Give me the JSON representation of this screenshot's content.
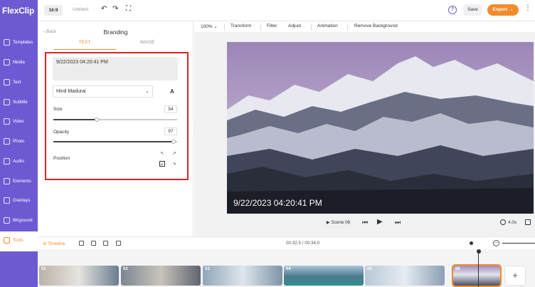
{
  "app": {
    "logo": "FlexClip",
    "ratio": "16:9",
    "project_title": "Untitled",
    "help": "?",
    "save_label": "Save",
    "export_label": "Export →",
    "more": "⋮"
  },
  "sidebar": {
    "items": [
      {
        "label": "Templates",
        "icon": "templates-icon"
      },
      {
        "label": "Media",
        "icon": "media-icon"
      },
      {
        "label": "Text",
        "icon": "text-icon"
      },
      {
        "label": "Subtitle",
        "icon": "subtitle-icon"
      },
      {
        "label": "Video",
        "icon": "video-icon"
      },
      {
        "label": "Photo",
        "icon": "photo-icon"
      },
      {
        "label": "Audio",
        "icon": "audio-icon"
      },
      {
        "label": "Elements",
        "icon": "elements-icon"
      },
      {
        "label": "Overlays",
        "icon": "overlays-icon"
      },
      {
        "label": "BKground",
        "icon": "background-icon"
      },
      {
        "label": "Tools",
        "icon": "tools-icon",
        "active": true
      }
    ]
  },
  "panel": {
    "back_label": "Back",
    "title": "Branding",
    "tabs": [
      "TEXT",
      "IMAGE"
    ],
    "active_tab": "TEXT",
    "text_value": "9/22/2023 04:20:41 PM",
    "font": "Hind Madurai",
    "font_style_glyph": "A",
    "size_label": "Size",
    "size_value": "54",
    "size_fraction": 0.35,
    "opacity_label": "Opacity",
    "opacity_value": "97",
    "opacity_fraction": 0.97,
    "position_label": "Position",
    "position_selected": "bottom-left"
  },
  "toolbar": {
    "zoom": "100%",
    "items": [
      "Transform",
      "Filter",
      "Adjust",
      "Animation",
      "Remove Background"
    ]
  },
  "preview": {
    "overlay_text": "9/22/2023 04:20:41 PM",
    "scene_label": "Scene 06",
    "duration": "4.0s"
  },
  "timeline": {
    "label": "Timeline",
    "time": "00:32.5 / 00:34.0",
    "zoom_fraction": 0.2,
    "clips": [
      {
        "num": "01"
      },
      {
        "num": "02"
      },
      {
        "num": "03"
      },
      {
        "num": "04"
      },
      {
        "num": "05"
      },
      {
        "num": "06",
        "selected": true
      }
    ],
    "add_label": "+"
  },
  "colors": {
    "brand_purple": "#6d5ad3",
    "accent_orange": "#f08c2b",
    "highlight_red": "#d8232a"
  }
}
